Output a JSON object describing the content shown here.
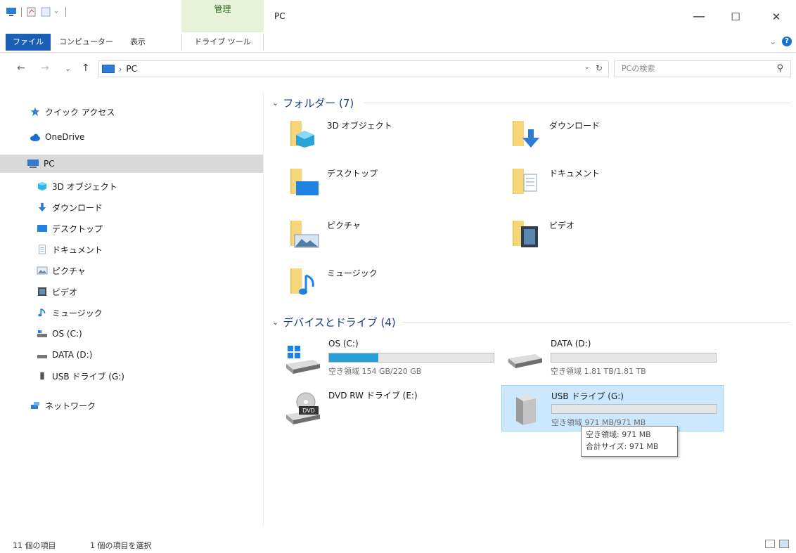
{
  "titlebar": {
    "manage_label": "管理",
    "title": "PC",
    "minimize": "—",
    "maximize": "☐",
    "close": "✕"
  },
  "ribbon": {
    "tabs": [
      "ファイル",
      "コンピューター",
      "表示"
    ],
    "drive_tools": "ドライブ ツール",
    "expand": "⌄",
    "help": "?"
  },
  "nav": {
    "back": "←",
    "forward": "→",
    "recent": "⌄",
    "up": "↑",
    "breadcrumb_sep": "›",
    "location": "PC",
    "search_placeholder": "PCの検索",
    "refresh": "↻",
    "addr_dropdown": "⌄",
    "search_icon": "⚲"
  },
  "sidebar": {
    "items": [
      {
        "label": "クイック アクセス",
        "icon": "star-icon"
      },
      {
        "label": "OneDrive",
        "icon": "cloud-icon"
      },
      {
        "label": "PC",
        "icon": "pc-icon",
        "selected": true
      },
      {
        "label": "3D オブジェクト",
        "icon": "3d-objects-icon"
      },
      {
        "label": "ダウンロード",
        "icon": "download-icon"
      },
      {
        "label": "デスクトップ",
        "icon": "desktop-icon"
      },
      {
        "label": "ドキュメント",
        "icon": "document-icon"
      },
      {
        "label": "ピクチャ",
        "icon": "picture-icon"
      },
      {
        "label": "ビデオ",
        "icon": "video-icon"
      },
      {
        "label": "ミュージック",
        "icon": "music-icon"
      },
      {
        "label": "OS (C:)",
        "icon": "os-drive-icon"
      },
      {
        "label": "DATA (D:)",
        "icon": "drive-icon"
      },
      {
        "label": "USB ドライブ (G:)",
        "icon": "usb-icon"
      },
      {
        "label": "ネットワーク",
        "icon": "network-icon"
      }
    ]
  },
  "main": {
    "folders_header": "フォルダー (7)",
    "folders": [
      {
        "label": "3D オブジェクト",
        "icon": "3d-objects-folder-icon"
      },
      {
        "label": "ダウンロード",
        "icon": "download-folder-icon"
      },
      {
        "label": "デスクトップ",
        "icon": "desktop-folder-icon"
      },
      {
        "label": "ドキュメント",
        "icon": "document-folder-icon"
      },
      {
        "label": "ピクチャ",
        "icon": "picture-folder-icon"
      },
      {
        "label": "ビデオ",
        "icon": "video-folder-icon"
      },
      {
        "label": "ミュージック",
        "icon": "music-folder-icon"
      }
    ],
    "drives_header": "デバイスとドライブ (4)",
    "drives": [
      {
        "name": "OS (C:)",
        "free": "空き領域 154 GB/220 GB",
        "used_fraction": 0.3,
        "icon": "windows-drive-icon"
      },
      {
        "name": "DATA (D:)",
        "free": "空き領域 1.81 TB/1.81 TB",
        "used_fraction": 0.0,
        "icon": "hard-drive-icon"
      },
      {
        "name": "DVD RW ドライブ (E:)",
        "icon": "dvd-drive-icon"
      },
      {
        "name": "USB ドライブ (G:)",
        "free": "空き領域 971 MB/971 MB",
        "used_fraction": 0.0,
        "icon": "usb-drive-icon",
        "selected": true
      }
    ],
    "tooltip": {
      "line1": "空き領域: 971 MB",
      "line2": "合計サイズ: 971 MB"
    }
  },
  "status": {
    "count": "11 個の項目",
    "selected": "1 個の項目を選択"
  },
  "colors": {
    "accent": "#1a5fb4",
    "bar_fill": "#26a0da",
    "selection": "#cce8ff",
    "folder": "#f3c757"
  }
}
